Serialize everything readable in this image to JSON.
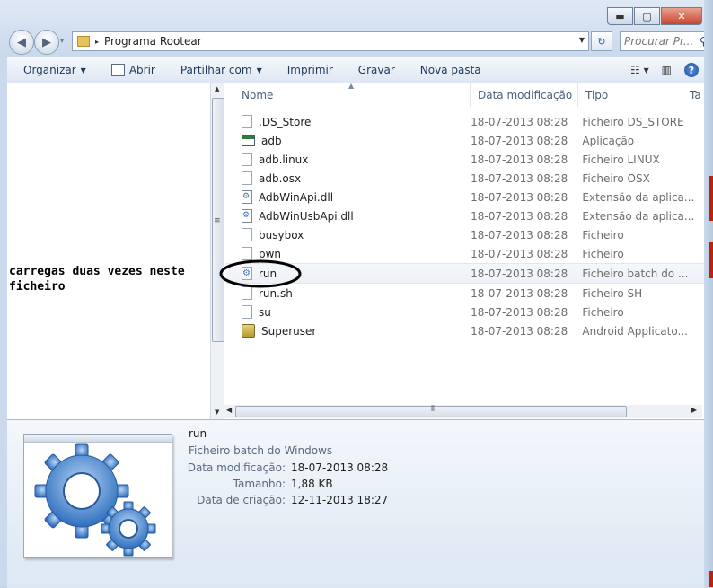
{
  "window": {
    "min": "▬",
    "max": "▢",
    "close": "✕"
  },
  "nav": {
    "back_icon": "back-arrow-icon",
    "forward_icon": "forward-arrow-icon",
    "path_arrow": "▸",
    "path": "Programa Rootear",
    "refresh_glyph": "↻",
    "search_placeholder": "Procurar Pr..."
  },
  "toolbar": {
    "organize": "Organizar",
    "open": "Abrir",
    "share": "Partilhar com",
    "print": "Imprimir",
    "burn": "Gravar",
    "new_folder": "Nova pasta",
    "help": "?"
  },
  "columns": {
    "name": "Nome",
    "date": "Data modificação",
    "type": "Tipo",
    "size": "Ta"
  },
  "files": [
    {
      "name": ".DS_Store",
      "date": "18-07-2013 08:28",
      "type": "Ficheiro DS_STORE",
      "icon": "blank"
    },
    {
      "name": "adb",
      "date": "18-07-2013 08:28",
      "type": "Aplicação",
      "icon": "app"
    },
    {
      "name": "adb.linux",
      "date": "18-07-2013 08:28",
      "type": "Ficheiro LINUX",
      "icon": "blank"
    },
    {
      "name": "adb.osx",
      "date": "18-07-2013 08:28",
      "type": "Ficheiro OSX",
      "icon": "blank"
    },
    {
      "name": "AdbWinApi.dll",
      "date": "18-07-2013 08:28",
      "type": "Extensão da aplica...",
      "icon": "dll"
    },
    {
      "name": "AdbWinUsbApi.dll",
      "date": "18-07-2013 08:28",
      "type": "Extensão da aplica...",
      "icon": "dll"
    },
    {
      "name": "busybox",
      "date": "18-07-2013 08:28",
      "type": "Ficheiro",
      "icon": "blank"
    },
    {
      "name": "pwn",
      "date": "18-07-2013 08:28",
      "type": "Ficheiro",
      "icon": "blank"
    },
    {
      "name": "run",
      "date": "18-07-2013 08:28",
      "type": "Ficheiro batch do ...",
      "icon": "bat"
    },
    {
      "name": "run.sh",
      "date": "18-07-2013 08:28",
      "type": "Ficheiro SH",
      "icon": "blank"
    },
    {
      "name": "su",
      "date": "18-07-2013 08:28",
      "type": "Ficheiro",
      "icon": "blank"
    },
    {
      "name": "Superuser",
      "date": "18-07-2013 08:28",
      "type": "Android Applicato...",
      "icon": "android"
    }
  ],
  "annotation": "carregas duas vezes neste ficheiro",
  "details": {
    "name": "run",
    "type": "Ficheiro batch do Windows",
    "props": [
      {
        "label": "Data modificação:",
        "value": "18-07-2013 08:28"
      },
      {
        "label": "Tamanho:",
        "value": "1,88 KB"
      },
      {
        "label": "Data de criação:",
        "value": "12-11-2013 18:27"
      }
    ]
  },
  "colors": {
    "gear": "#4f8fd8",
    "annotation_circle": "#000000",
    "border_accent": "#b8220e"
  }
}
